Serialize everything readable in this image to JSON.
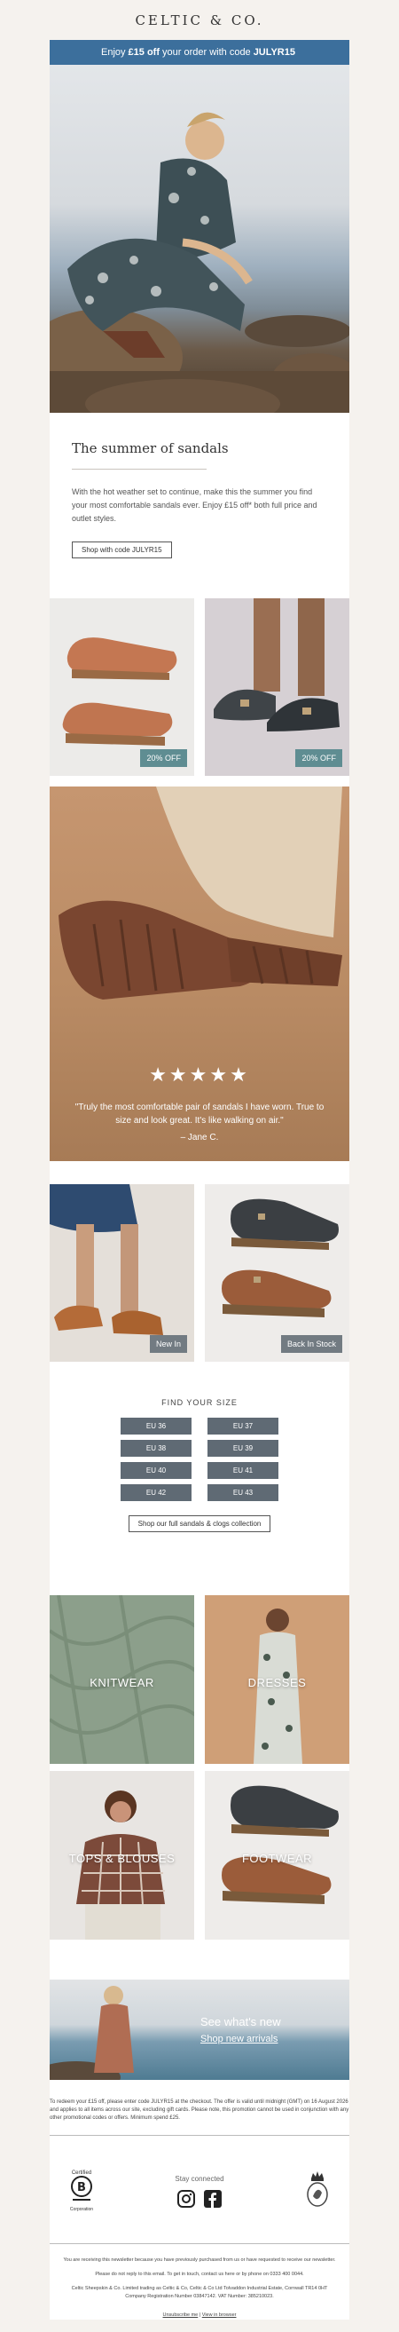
{
  "brand": {
    "logo_text": "CELTIC & CO."
  },
  "banner": {
    "prefix": "Enjoy",
    "amount": "£15 off",
    "middle": "your order with code",
    "code": "JULYR15"
  },
  "intro": {
    "title": "The summer of sandals",
    "body": "With the hot weather set to continue, make this the summer you find your most comfortable sandals ever. Enjoy £15 off* both full price and outlet styles.",
    "button": "Shop with code JULYR15"
  },
  "offers": [
    {
      "badge": "20% OFF"
    },
    {
      "badge": "20% OFF"
    }
  ],
  "review": {
    "stars": "★★★★★",
    "quote": "\"Truly the most comfortable pair of sandals I have worn. True to size and look great. It's like walking on air.\"",
    "author": "– Jane C."
  },
  "new_in": [
    {
      "badge": "New In"
    },
    {
      "badge": "Back In Stock"
    }
  ],
  "size_finder": {
    "title": "FIND YOUR SIZE",
    "sizes": [
      "EU 36",
      "EU 37",
      "EU 38",
      "EU 39",
      "EU 40",
      "EU 41",
      "EU 42",
      "EU 43"
    ],
    "button": "Shop our full sandals & clogs collection"
  },
  "categories": [
    {
      "label": "KNITWEAR"
    },
    {
      "label": "DRESSES"
    },
    {
      "label": "TOPS & BLOUSES"
    },
    {
      "label": "FOOTWEAR"
    }
  ],
  "footer_hero": {
    "headline": "See what's new",
    "link": "Shop new arrivals"
  },
  "terms": "To redeem your £15 off, please enter code JULYR15 at the checkout. The offer is valid until midnight (GMT) on 16 August 2026 and applies to all items across our site, excluding gift cards. Please note, this promotion cannot be used in conjunction with any other promotional codes or offers. Minimum spend £25.",
  "social": {
    "connect": "Stay connected",
    "certified": "Certified",
    "corporation": "Corporation"
  },
  "legal": {
    "line1": "You are receiving this newsletter because you have previously purchased from us or have requested to receive our newsletter.",
    "line2": "Please do not reply to this email. To get in touch, contact us here or by phone on 0333 400 0044.",
    "line3": "Celtic Sheepskin & Co. Limited trading as Celtic & Co, Celtic & Co Ltd Tolvaddon Industrial Estate, Cornwall TR14 0HT",
    "line4": "Company Registration Number 03847142. VAT Number: 385210023.",
    "unsubscribe": "Unsubscribe me",
    "browser": "View in browser"
  },
  "colors": {
    "banner": "#3c6f9c",
    "offer_badge": "#5f8d92",
    "size_button": "#5f6a74"
  }
}
